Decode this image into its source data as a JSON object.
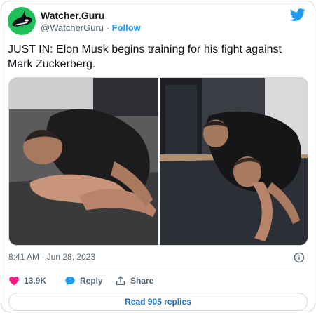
{
  "account": {
    "display_name": "Watcher.Guru",
    "handle": "@WatcherGuru",
    "separator": "·",
    "follow_label": "Follow"
  },
  "tweet": {
    "text": "JUST IN: Elon Musk begins training for his fight against Mark Zuckerberg."
  },
  "meta": {
    "timestamp": "8:41 AM · Jun 28, 2023"
  },
  "actions": {
    "likes": "13.9K",
    "reply_label": "Reply",
    "share_label": "Share"
  },
  "footer": {
    "read_replies_label": "Read 905 replies"
  },
  "colors": {
    "accent": "#1d9bf0",
    "avatar_bg": "#1fc05a",
    "like": "#f91880"
  }
}
